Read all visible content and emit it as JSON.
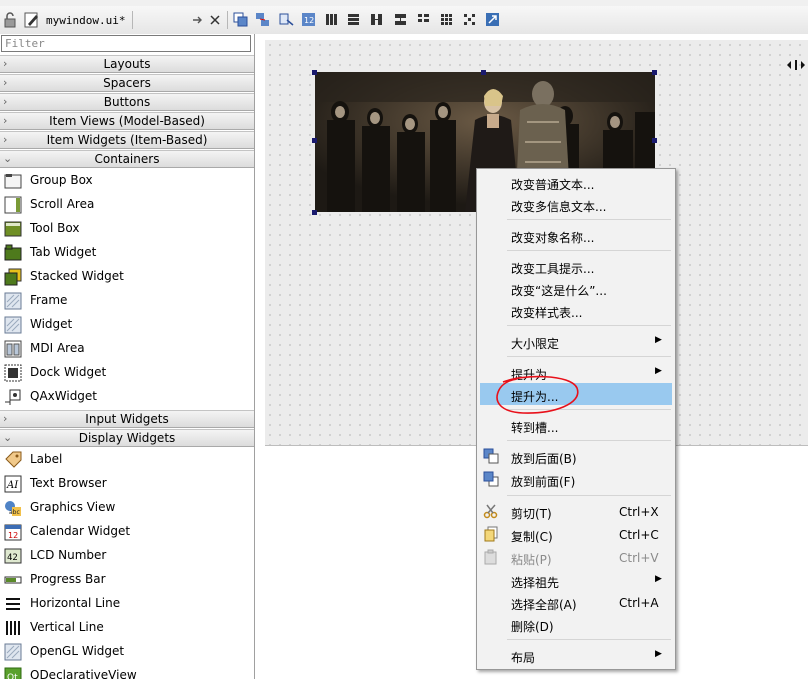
{
  "toolbar": {
    "file_tab": "mywindow.ui*"
  },
  "widgetbox": {
    "filter_placeholder": "Filter",
    "categories_top": [
      {
        "label": "Layouts",
        "expanded": false
      },
      {
        "label": "Spacers",
        "expanded": false
      },
      {
        "label": "Buttons",
        "expanded": false
      },
      {
        "label": "Item Views (Model-Based)",
        "expanded": false
      },
      {
        "label": "Item Widgets (Item-Based)",
        "expanded": false
      },
      {
        "label": "Containers",
        "expanded": true
      }
    ],
    "containers": [
      {
        "label": "Group Box",
        "icon": "group-box-icon"
      },
      {
        "label": "Scroll Area",
        "icon": "scroll-area-icon"
      },
      {
        "label": "Tool Box",
        "icon": "tool-box-icon"
      },
      {
        "label": "Tab Widget",
        "icon": "tab-widget-icon"
      },
      {
        "label": "Stacked Widget",
        "icon": "stacked-widget-icon"
      },
      {
        "label": "Frame",
        "icon": "frame-icon"
      },
      {
        "label": "Widget",
        "icon": "widget-icon"
      },
      {
        "label": "MDI Area",
        "icon": "mdi-area-icon"
      },
      {
        "label": "Dock Widget",
        "icon": "dock-widget-icon"
      },
      {
        "label": "QAxWidget",
        "icon": "qaxwidget-icon"
      }
    ],
    "categories_mid": [
      {
        "label": "Input Widgets",
        "expanded": false
      },
      {
        "label": "Display Widgets",
        "expanded": true
      }
    ],
    "display_widgets": [
      {
        "label": "Label",
        "icon": "label-icon"
      },
      {
        "label": "Text Browser",
        "icon": "text-browser-icon"
      },
      {
        "label": "Graphics View",
        "icon": "graphics-view-icon"
      },
      {
        "label": "Calendar Widget",
        "icon": "calendar-widget-icon"
      },
      {
        "label": "LCD Number",
        "icon": "lcd-number-icon"
      },
      {
        "label": "Progress Bar",
        "icon": "progress-bar-icon"
      },
      {
        "label": "Horizontal Line",
        "icon": "horizontal-line-icon"
      },
      {
        "label": "Vertical Line",
        "icon": "vertical-line-icon"
      },
      {
        "label": "OpenGL Widget",
        "icon": "opengl-widget-icon"
      },
      {
        "label": "QDeclarativeView",
        "icon": "qdeclarativeview-icon"
      }
    ]
  },
  "context_menu": {
    "items": [
      {
        "label": "改变普通文本..."
      },
      {
        "label": "改变多信息文本..."
      },
      {
        "label": "改变对象名称..."
      },
      {
        "label": "改变工具提示..."
      },
      {
        "label": "改变“这是什么”..."
      },
      {
        "label": "改变样式表..."
      },
      {
        "label": "大小限定"
      },
      {
        "label": "提升为"
      },
      {
        "label": "提升为...",
        "highlighted": true
      },
      {
        "label": "转到槽..."
      },
      {
        "label": "放到后面(B)"
      },
      {
        "label": "放到前面(F)"
      },
      {
        "label": "剪切(T)",
        "shortcut": "Ctrl+X"
      },
      {
        "label": "复制(C)",
        "shortcut": "Ctrl+C"
      },
      {
        "label": "粘贴(P)",
        "shortcut": "Ctrl+V",
        "disabled": true
      },
      {
        "label": "选择祖先"
      },
      {
        "label": "选择全部(A)",
        "shortcut": "Ctrl+A"
      },
      {
        "label": "删除(D)"
      },
      {
        "label": "布局"
      }
    ]
  },
  "colors": {
    "highlight": "#99c9ef",
    "annotation_circle": "#e8101a",
    "selection_handle": "#1a1a6e"
  }
}
